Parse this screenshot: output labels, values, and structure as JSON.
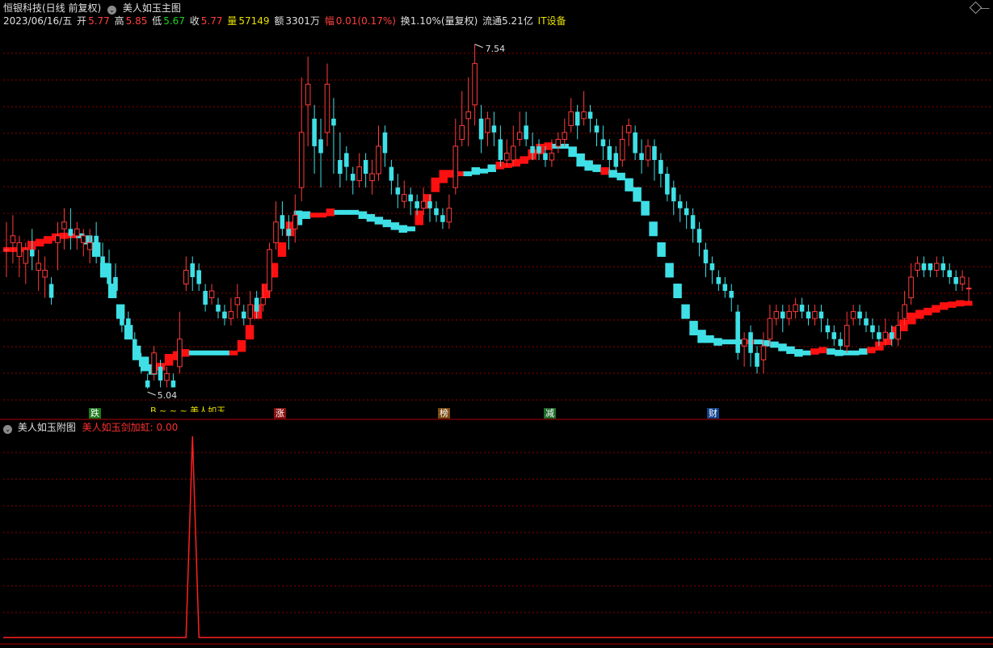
{
  "header": {
    "stock_title": "恒银科技(日线 前复权)",
    "indicator_name": "美人如玉主图",
    "collapse_icon": "chevron-down-icon"
  },
  "info": {
    "date": "2023/06/16/五",
    "open_label": "开",
    "open": "5.77",
    "high_label": "高",
    "high": "5.85",
    "low_label": "低",
    "low": "5.67",
    "close_label": "收",
    "close": "5.77",
    "volume_label": "量",
    "volume": "57149",
    "amount_label": "额",
    "amount": "3301万",
    "change_label": "幅",
    "change": "0.01(0.17%)",
    "turnover": "换1.10%(量复权)",
    "float_cap": "流通5.21亿",
    "sector": "IT设备"
  },
  "markers": {
    "max_label": "7.54",
    "min_label": "5.04",
    "legend_partial": "B ~ ~ ~ 美人如玉",
    "badges": [
      "跌",
      "涨",
      "榜",
      "减",
      "财"
    ]
  },
  "sub_panel": {
    "title": "美人如玉附图",
    "series_label": "美人如玉剑加虹:",
    "series_value": "0.00"
  },
  "colors": {
    "up": "#ff3b3b",
    "down": "#3ee0e6",
    "band_up": "#ff1010",
    "band_down": "#3ee0e6",
    "grid": "#8b0000",
    "yellow": "#e8e000",
    "text": "#c8c8c8"
  },
  "chart_data": [
    {
      "type": "candlestick",
      "title": "美人如玉主图",
      "ylim": [
        4.9,
        7.65
      ],
      "grid": true,
      "candles": [
        [
          6.05,
          6.05,
          6.25,
          5.85
        ],
        [
          6.1,
          6.15,
          6.3,
          5.95
        ],
        [
          6.0,
          6.1,
          6.15,
          5.85
        ],
        [
          5.95,
          6.05,
          6.1,
          5.8
        ],
        [
          6.05,
          6.0,
          6.2,
          5.9
        ],
        [
          5.9,
          5.95,
          6.05,
          5.75
        ],
        [
          5.85,
          5.9,
          6.0,
          5.7
        ],
        [
          5.8,
          5.7,
          5.85,
          5.65
        ],
        [
          6.1,
          6.15,
          6.25,
          5.9
        ],
        [
          6.2,
          6.25,
          6.35,
          6.05
        ],
        [
          6.2,
          6.15,
          6.35,
          6.05
        ],
        [
          6.15,
          6.2,
          6.25,
          6.05
        ],
        [
          6.1,
          6.15,
          6.2,
          6.0
        ],
        [
          6.05,
          6.1,
          6.2,
          5.95
        ],
        [
          6.15,
          6.05,
          6.25,
          5.95
        ],
        [
          6.0,
          5.95,
          6.1,
          5.9
        ],
        [
          5.95,
          5.8,
          6.05,
          5.75
        ],
        [
          5.85,
          5.75,
          5.95,
          5.7
        ],
        [
          5.6,
          5.5,
          5.65,
          5.45
        ],
        [
          5.55,
          5.45,
          5.6,
          5.4
        ],
        [
          5.4,
          5.35,
          5.45,
          5.3
        ],
        [
          5.25,
          5.2,
          5.3,
          5.15
        ],
        [
          5.1,
          5.05,
          5.15,
          5.04
        ],
        [
          5.15,
          5.3,
          5.35,
          5.1
        ],
        [
          5.2,
          5.1,
          5.25,
          5.05
        ],
        [
          5.1,
          5.15,
          5.2,
          5.05
        ],
        [
          5.1,
          5.05,
          5.15,
          5.05
        ],
        [
          5.2,
          5.4,
          5.6,
          5.15
        ],
        [
          5.8,
          5.9,
          6.0,
          5.75
        ],
        [
          5.95,
          5.85,
          6.0,
          5.75
        ],
        [
          5.9,
          5.8,
          5.95,
          5.75
        ],
        [
          5.75,
          5.65,
          5.8,
          5.6
        ],
        [
          5.7,
          5.75,
          5.8,
          5.65
        ],
        [
          5.65,
          5.6,
          5.7,
          5.55
        ],
        [
          5.6,
          5.55,
          5.65,
          5.5
        ],
        [
          5.55,
          5.6,
          5.7,
          5.5
        ],
        [
          5.65,
          5.7,
          5.8,
          5.55
        ],
        [
          5.6,
          5.55,
          5.65,
          5.5
        ],
        [
          5.55,
          5.65,
          5.75,
          5.5
        ],
        [
          5.7,
          5.6,
          5.75,
          5.55
        ],
        [
          5.65,
          5.7,
          5.8,
          5.6
        ],
        [
          5.75,
          6.05,
          6.1,
          5.7
        ],
        [
          6.1,
          6.25,
          6.4,
          6.05
        ],
        [
          6.3,
          6.2,
          6.4,
          6.15
        ],
        [
          6.2,
          6.15,
          6.3,
          6.05
        ],
        [
          6.2,
          6.3,
          6.45,
          6.1
        ],
        [
          6.5,
          6.9,
          7.3,
          6.4
        ],
        [
          7.1,
          7.25,
          7.45,
          6.8
        ],
        [
          7.0,
          6.8,
          7.1,
          6.6
        ],
        [
          6.85,
          6.75,
          7.0,
          6.5
        ],
        [
          6.9,
          7.25,
          7.4,
          6.8
        ],
        [
          7.0,
          6.95,
          7.15,
          6.6
        ],
        [
          6.7,
          6.6,
          6.9,
          6.5
        ],
        [
          6.75,
          6.65,
          6.8,
          6.55
        ],
        [
          6.6,
          6.55,
          6.65,
          6.45
        ],
        [
          6.55,
          6.65,
          6.75,
          6.5
        ],
        [
          6.7,
          6.6,
          6.75,
          6.5
        ],
        [
          6.55,
          6.6,
          6.7,
          6.45
        ],
        [
          6.6,
          6.8,
          6.95,
          6.55
        ],
        [
          6.9,
          6.75,
          6.95,
          6.65
        ],
        [
          6.65,
          6.55,
          6.7,
          6.45
        ],
        [
          6.5,
          6.45,
          6.6,
          6.35
        ],
        [
          6.4,
          6.45,
          6.55,
          6.35
        ],
        [
          6.45,
          6.4,
          6.5,
          6.3
        ],
        [
          6.4,
          6.35,
          6.45,
          6.3
        ],
        [
          6.35,
          6.4,
          6.5,
          6.3
        ],
        [
          6.4,
          6.35,
          6.45,
          6.25
        ],
        [
          6.35,
          6.3,
          6.4,
          6.25
        ],
        [
          6.3,
          6.25,
          6.35,
          6.2
        ],
        [
          6.25,
          6.35,
          6.45,
          6.2
        ],
        [
          6.5,
          6.8,
          7.0,
          6.45
        ],
        [
          6.85,
          6.95,
          7.2,
          6.8
        ],
        [
          7.0,
          7.05,
          7.3,
          6.8
        ],
        [
          7.1,
          7.4,
          7.54,
          6.95
        ],
        [
          7.0,
          6.85,
          7.1,
          6.75
        ],
        [
          6.9,
          7.0,
          7.05,
          6.8
        ],
        [
          6.95,
          6.9,
          7.05,
          6.8
        ],
        [
          6.85,
          6.7,
          6.95,
          6.65
        ],
        [
          6.7,
          6.75,
          6.85,
          6.65
        ],
        [
          6.7,
          6.8,
          6.95,
          6.65
        ],
        [
          6.85,
          6.9,
          7.05,
          6.8
        ],
        [
          6.95,
          6.85,
          7.05,
          6.8
        ],
        [
          6.8,
          6.75,
          6.9,
          6.7
        ],
        [
          6.8,
          6.75,
          6.85,
          6.7
        ],
        [
          6.75,
          6.7,
          6.8,
          6.65
        ],
        [
          6.7,
          6.75,
          6.85,
          6.65
        ],
        [
          6.8,
          6.85,
          6.9,
          6.75
        ],
        [
          6.85,
          6.9,
          7.0,
          6.8
        ],
        [
          6.95,
          7.05,
          7.15,
          6.9
        ],
        [
          7.05,
          6.95,
          7.1,
          6.85
        ],
        [
          7.0,
          7.05,
          7.2,
          6.95
        ],
        [
          7.05,
          7.0,
          7.1,
          6.9
        ],
        [
          6.95,
          6.9,
          7.0,
          6.8
        ],
        [
          6.85,
          6.8,
          6.95,
          6.7
        ],
        [
          6.8,
          6.7,
          6.85,
          6.6
        ],
        [
          6.75,
          6.65,
          6.8,
          6.6
        ],
        [
          6.7,
          6.85,
          6.95,
          6.65
        ],
        [
          6.9,
          6.95,
          7.0,
          6.8
        ],
        [
          6.9,
          6.75,
          6.95,
          6.7
        ],
        [
          6.75,
          6.7,
          6.85,
          6.6
        ],
        [
          6.7,
          6.8,
          6.85,
          6.65
        ],
        [
          6.8,
          6.7,
          6.85,
          6.55
        ],
        [
          6.7,
          6.6,
          6.75,
          6.5
        ],
        [
          6.6,
          6.45,
          6.65,
          6.4
        ],
        [
          6.5,
          6.4,
          6.55,
          6.3
        ],
        [
          6.4,
          6.35,
          6.45,
          6.25
        ],
        [
          6.35,
          6.3,
          6.4,
          6.2
        ],
        [
          6.3,
          6.2,
          6.35,
          6.1
        ],
        [
          6.2,
          6.1,
          6.25,
          6.0
        ],
        [
          6.05,
          5.95,
          6.1,
          5.85
        ],
        [
          5.95,
          5.9,
          6.0,
          5.8
        ],
        [
          5.85,
          5.8,
          5.9,
          5.75
        ],
        [
          5.8,
          5.75,
          5.85,
          5.7
        ],
        [
          5.75,
          5.7,
          5.8,
          5.6
        ],
        [
          5.6,
          5.3,
          5.65,
          5.25
        ],
        [
          5.35,
          5.4,
          5.45,
          5.2
        ],
        [
          5.45,
          5.3,
          5.5,
          5.2
        ],
        [
          5.3,
          5.2,
          5.35,
          5.15
        ],
        [
          5.25,
          5.35,
          5.45,
          5.15
        ],
        [
          5.4,
          5.55,
          5.65,
          5.35
        ],
        [
          5.55,
          5.6,
          5.65,
          5.5
        ],
        [
          5.6,
          5.55,
          5.65,
          5.45
        ],
        [
          5.55,
          5.6,
          5.65,
          5.5
        ],
        [
          5.6,
          5.65,
          5.7,
          5.55
        ],
        [
          5.65,
          5.6,
          5.7,
          5.55
        ],
        [
          5.6,
          5.55,
          5.65,
          5.5
        ],
        [
          5.55,
          5.6,
          5.65,
          5.5
        ],
        [
          5.6,
          5.55,
          5.65,
          5.45
        ],
        [
          5.5,
          5.45,
          5.55,
          5.4
        ],
        [
          5.45,
          5.4,
          5.5,
          5.35
        ],
        [
          5.4,
          5.35,
          5.45,
          5.3
        ],
        [
          5.35,
          5.5,
          5.6,
          5.3
        ],
        [
          5.55,
          5.6,
          5.65,
          5.5
        ],
        [
          5.6,
          5.55,
          5.65,
          5.5
        ],
        [
          5.55,
          5.5,
          5.6,
          5.45
        ],
        [
          5.5,
          5.45,
          5.55,
          5.4
        ],
        [
          5.45,
          5.4,
          5.5,
          5.35
        ],
        [
          5.4,
          5.45,
          5.55,
          5.35
        ],
        [
          5.45,
          5.4,
          5.5,
          5.35
        ],
        [
          5.4,
          5.5,
          5.6,
          5.35
        ],
        [
          5.55,
          5.65,
          5.75,
          5.5
        ],
        [
          5.7,
          5.85,
          5.95,
          5.65
        ],
        [
          5.9,
          5.95,
          6.0,
          5.85
        ],
        [
          5.95,
          5.9,
          6.0,
          5.85
        ],
        [
          5.95,
          5.9,
          5.95,
          5.85
        ],
        [
          5.9,
          5.95,
          6.0,
          5.85
        ],
        [
          5.95,
          5.9,
          6.0,
          5.85
        ],
        [
          5.9,
          5.85,
          5.95,
          5.8
        ],
        [
          5.85,
          5.8,
          5.9,
          5.75
        ],
        [
          5.8,
          5.85,
          5.9,
          5.75
        ],
        [
          5.77,
          5.77,
          5.85,
          5.67
        ]
      ],
      "band": [
        6.05,
        6.05,
        6.05,
        6.08,
        6.1,
        6.12,
        6.14,
        6.15,
        6.15,
        6.15,
        6.12,
        6.05,
        5.9,
        5.75,
        5.6,
        5.45,
        5.3,
        5.22,
        5.18,
        5.2,
        5.25,
        5.28,
        5.3,
        5.3,
        5.3,
        5.3,
        5.3,
        5.3,
        5.3,
        5.35,
        5.45,
        5.6,
        5.75,
        5.9,
        6.05,
        6.2,
        6.28,
        6.3,
        6.3,
        6.3,
        6.32,
        6.32,
        6.32,
        6.32,
        6.3,
        6.28,
        6.26,
        6.24,
        6.22,
        6.2,
        6.2,
        6.28,
        6.4,
        6.52,
        6.58,
        6.6,
        6.6,
        6.6,
        6.62,
        6.62,
        6.64,
        6.66,
        6.66,
        6.68,
        6.7,
        6.74,
        6.78,
        6.8,
        6.8,
        6.8,
        6.76,
        6.7,
        6.66,
        6.64,
        6.62,
        6.6,
        6.58,
        6.52,
        6.45,
        6.35,
        6.2,
        6.05,
        5.9,
        5.75,
        5.6,
        5.48,
        5.42,
        5.4,
        5.38,
        5.38,
        5.38,
        5.38,
        5.38,
        5.38,
        5.37,
        5.36,
        5.34,
        5.32,
        5.3,
        5.3,
        5.31,
        5.32,
        5.31,
        5.3,
        5.3,
        5.3,
        5.31,
        5.32,
        5.35,
        5.4,
        5.45,
        5.5,
        5.55,
        5.58,
        5.6,
        5.62,
        5.64,
        5.65,
        5.66,
        5.66
      ],
      "band_trend": [
        1,
        1,
        1,
        1,
        1,
        1,
        1,
        1,
        1,
        0,
        0,
        0,
        0,
        0,
        0,
        0,
        0,
        0,
        0,
        1,
        1,
        1,
        1,
        0,
        0,
        0,
        0,
        0,
        1,
        1,
        1,
        1,
        1,
        1,
        1,
        1,
        0,
        0,
        1,
        1,
        1,
        0,
        0,
        0,
        0,
        0,
        0,
        0,
        0,
        0,
        0,
        1,
        1,
        1,
        1,
        1,
        1,
        0,
        0,
        0,
        0,
        1,
        1,
        1,
        1,
        1,
        1,
        1,
        0,
        0,
        0,
        0,
        0,
        0,
        1,
        0,
        0,
        0,
        0,
        0,
        0,
        0,
        0,
        0,
        0,
        0,
        0,
        0,
        0,
        0,
        0,
        0,
        1,
        0,
        0,
        0,
        0,
        0,
        0,
        0,
        1,
        1,
        0,
        0,
        0,
        0,
        0,
        1,
        1,
        1,
        1,
        1,
        1,
        1,
        1,
        1,
        1,
        1,
        1,
        1
      ]
    },
    {
      "type": "line",
      "title": "美人如玉附图",
      "series": [
        {
          "name": "美人如玉剑加虹",
          "spike_index": 29,
          "spike_value": 1.0,
          "baseline": 0.0
        }
      ]
    }
  ]
}
